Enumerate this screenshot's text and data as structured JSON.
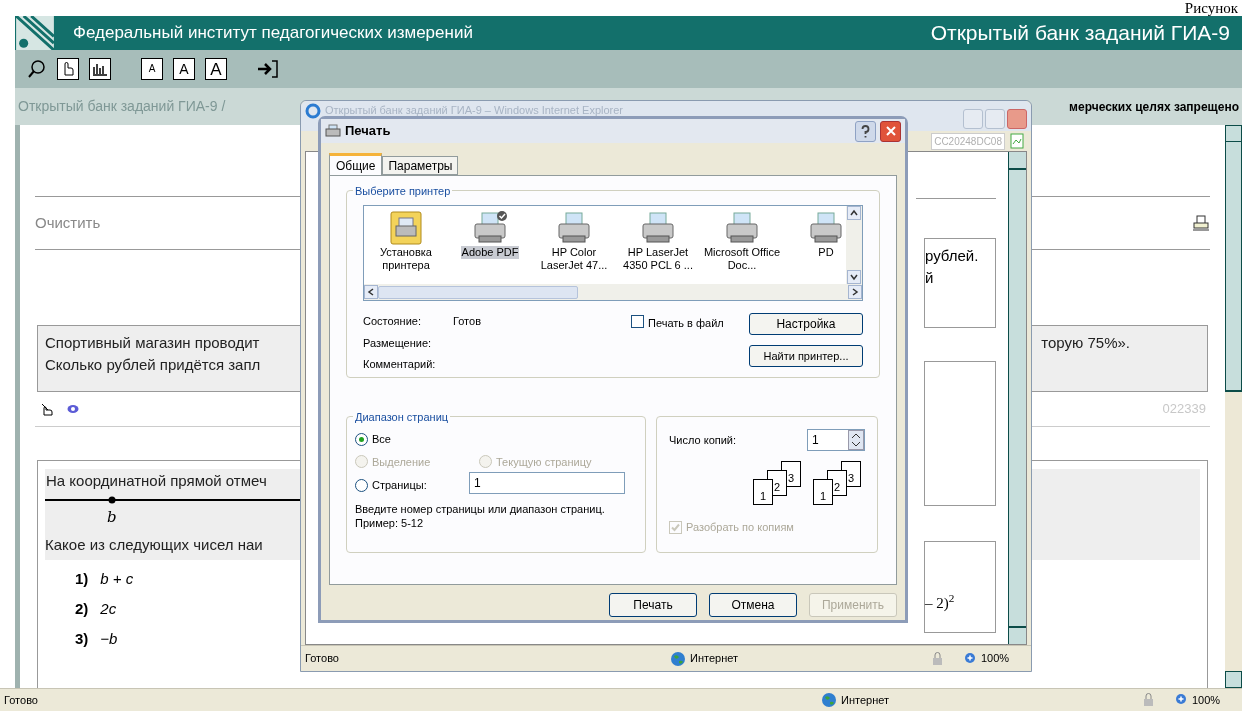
{
  "caption": "Рисунок",
  "header": {
    "title": "Федеральный институт педагогических измерений",
    "bank_title": "Открытый банк заданий ГИА-9"
  },
  "toolbar": {
    "font_buttons": [
      {
        "label": "A",
        "kind": "small"
      },
      {
        "label": "A",
        "kind": "medium"
      },
      {
        "label": "A",
        "kind": "large"
      }
    ]
  },
  "breadcrumb": {
    "path": "Открытый банк заданий ГИА-9 /",
    "notice": "мерческих целях запрещено"
  },
  "clear_link": "Очистить",
  "task1": {
    "lines": [
      "Спортивный магазин проводит",
      "Сколько рублей придётся запл"
    ],
    "right_fragment": "торую 75%».",
    "task_id": "022339"
  },
  "task2": {
    "intro": "На координатной прямой отмеч",
    "point_label": "b",
    "question": "Какое из следующих чисел наи",
    "answers": [
      {
        "number": "1)",
        "expr": "b + c"
      },
      {
        "number": "2)",
        "expr": "2c"
      },
      {
        "number": "3)",
        "expr": "−b"
      }
    ]
  },
  "status_bar": {
    "status": "Готово",
    "zone": "Интернет",
    "zoom": "100%"
  },
  "ie_window": {
    "title": "Открытый банк заданий ГИА-9 – Windows Internet Explorer",
    "address": "CC20248DC08",
    "fragments": [
      "рублей.",
      "й"
    ],
    "formula": "– 2)$^{2}$",
    "status_bar": {
      "status": "Готово",
      "zone": "Интернет",
      "zoom": "100%"
    }
  },
  "print_dialog": {
    "title": "Печать",
    "tabs": [
      {
        "label": "Общие",
        "selected": true
      },
      {
        "label": "Параметры",
        "selected": false
      }
    ],
    "printer_group": "Выберите принтер",
    "printers": [
      {
        "label": "Установка принтера",
        "kind": "add",
        "selected": false,
        "default": false
      },
      {
        "label": "Adobe PDF",
        "kind": "printer",
        "selected": true,
        "default": true
      },
      {
        "label": "HP Color LaserJet 47...",
        "kind": "printer",
        "selected": false,
        "default": false
      },
      {
        "label": "HP LaserJet 4350 PCL 6 ...",
        "kind": "printer",
        "selected": false,
        "default": false
      },
      {
        "label": "Microsoft Office Doc...",
        "kind": "printer",
        "selected": false,
        "default": false
      },
      {
        "label": "PD",
        "kind": "printer",
        "selected": false,
        "default": false
      }
    ],
    "info": [
      {
        "label": "Состояние:",
        "value": "Готов"
      },
      {
        "label": "Размещение:"
      },
      {
        "label": "Комментарий:"
      }
    ],
    "print_to_file": {
      "label": "Печать в файл",
      "checked": false
    },
    "setup_button": "Настройка",
    "find_button": "Найти принтер...",
    "range_group": "Диапазон страниц",
    "range_options": [
      {
        "label": "Все",
        "selected": true,
        "disabled": false
      },
      {
        "label": "Выделение",
        "selected": false,
        "disabled": true
      },
      {
        "label": "Текущую страницу",
        "selected": false,
        "disabled": true
      },
      {
        "label": "Страницы:",
        "selected": false,
        "disabled": false
      }
    ],
    "pages_value": "1",
    "hint": "Введите номер страницы или диапазон страниц.  Пример: 5-12",
    "copies_label": "Число копий:",
    "copies_value": "1",
    "collate_stacks": [
      {
        "pages": [
          "1",
          "2",
          "3"
        ]
      },
      {
        "pages": [
          "1",
          "2",
          "3"
        ]
      }
    ],
    "collate": {
      "label": "Разобрать по копиям",
      "checked": true,
      "disabled": true
    },
    "buttons": [
      {
        "label": "Печать",
        "disabled": false
      },
      {
        "label": "Отмена",
        "disabled": false
      },
      {
        "label": "Применить",
        "disabled": true
      }
    ]
  }
}
